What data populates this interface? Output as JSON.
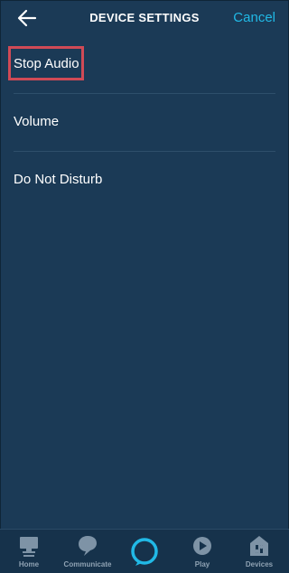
{
  "header": {
    "back_icon": "arrow-left-icon",
    "title": "DEVICE SETTINGS",
    "cancel_label": "Cancel"
  },
  "menu": {
    "items": [
      {
        "label": "Stop Audio",
        "highlighted": true
      },
      {
        "label": "Volume"
      },
      {
        "label": "Do Not Disturb"
      }
    ]
  },
  "tabbar": {
    "tabs": [
      {
        "label": "Home",
        "icon": "home-icon"
      },
      {
        "label": "Communicate",
        "icon": "chat-bubble-icon"
      },
      {
        "label": "",
        "icon": "alexa-ring-icon"
      },
      {
        "label": "Play",
        "icon": "play-icon"
      },
      {
        "label": "Devices",
        "icon": "devices-icon"
      }
    ]
  },
  "colors": {
    "background": "#1b3a56",
    "accent": "#21b9e6",
    "highlight_border": "#d04a56",
    "tab_icon": "#7e93a6"
  }
}
